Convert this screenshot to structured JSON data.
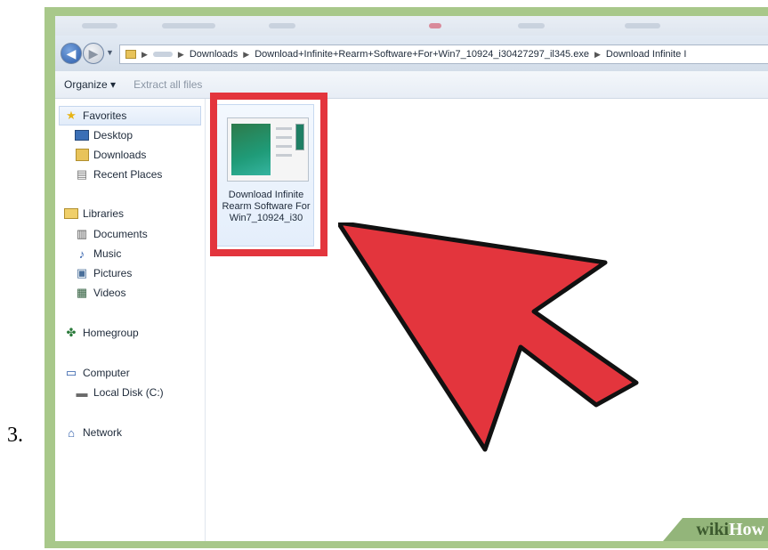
{
  "step_number": "3.",
  "address_bar": {
    "crumbs": [
      "Downloads",
      "Download+Infinite+Rearm+Software+For+Win7_10924_i30427297_il345.exe",
      "Download Infinite I"
    ]
  },
  "toolbar": {
    "organize_label": "Organize ▾",
    "extract_label": "Extract all files"
  },
  "nav": {
    "favorites": "Favorites",
    "desktop": "Desktop",
    "downloads": "Downloads",
    "recent_places": "Recent Places",
    "libraries": "Libraries",
    "documents": "Documents",
    "music": "Music",
    "pictures": "Pictures",
    "videos": "Videos",
    "homegroup": "Homegroup",
    "computer": "Computer",
    "local_disk": "Local Disk (C:)",
    "network": "Network"
  },
  "file": {
    "name": "Download Infinite Rearm Software For Win7_10924_i30"
  },
  "watermark": {
    "part1": "wiki",
    "part2": "How"
  },
  "colors": {
    "highlight_red": "#e3353d",
    "frame_green": "#a8c88a"
  }
}
